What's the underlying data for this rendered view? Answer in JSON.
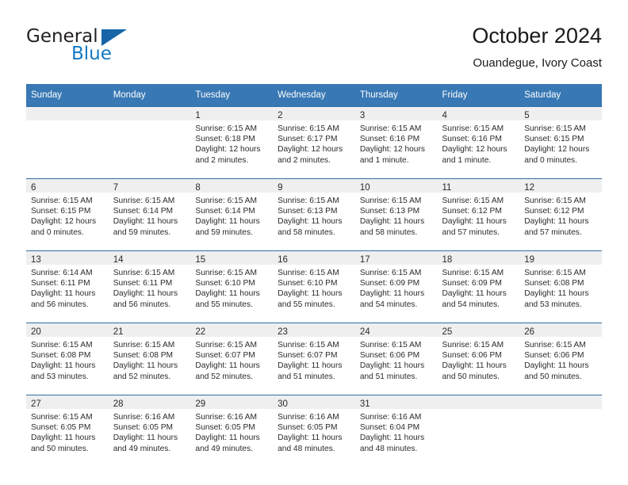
{
  "brand": {
    "name_top": "General",
    "name_bottom": "Blue",
    "accent_color": "#1579c4",
    "triangle_color": "#1565a8"
  },
  "header": {
    "title": "October 2024",
    "subtitle": "Ouandegue, Ivory Coast"
  },
  "theme": {
    "header_row_bg": "#3878b4",
    "daynum_band_bg": "#efefef",
    "row_border": "#2f6fa8",
    "text": "#2b2b2b"
  },
  "calendar": {
    "weekday_headers": [
      "Sunday",
      "Monday",
      "Tuesday",
      "Wednesday",
      "Thursday",
      "Friday",
      "Saturday"
    ],
    "weeks": [
      [
        {
          "day": ""
        },
        {
          "day": ""
        },
        {
          "day": "1",
          "sunrise": "Sunrise: 6:15 AM",
          "sunset": "Sunset: 6:18 PM",
          "daylight_1": "Daylight: 12 hours",
          "daylight_2": "and 2 minutes."
        },
        {
          "day": "2",
          "sunrise": "Sunrise: 6:15 AM",
          "sunset": "Sunset: 6:17 PM",
          "daylight_1": "Daylight: 12 hours",
          "daylight_2": "and 2 minutes."
        },
        {
          "day": "3",
          "sunrise": "Sunrise: 6:15 AM",
          "sunset": "Sunset: 6:16 PM",
          "daylight_1": "Daylight: 12 hours",
          "daylight_2": "and 1 minute."
        },
        {
          "day": "4",
          "sunrise": "Sunrise: 6:15 AM",
          "sunset": "Sunset: 6:16 PM",
          "daylight_1": "Daylight: 12 hours",
          "daylight_2": "and 1 minute."
        },
        {
          "day": "5",
          "sunrise": "Sunrise: 6:15 AM",
          "sunset": "Sunset: 6:15 PM",
          "daylight_1": "Daylight: 12 hours",
          "daylight_2": "and 0 minutes."
        }
      ],
      [
        {
          "day": "6",
          "sunrise": "Sunrise: 6:15 AM",
          "sunset": "Sunset: 6:15 PM",
          "daylight_1": "Daylight: 12 hours",
          "daylight_2": "and 0 minutes."
        },
        {
          "day": "7",
          "sunrise": "Sunrise: 6:15 AM",
          "sunset": "Sunset: 6:14 PM",
          "daylight_1": "Daylight: 11 hours",
          "daylight_2": "and 59 minutes."
        },
        {
          "day": "8",
          "sunrise": "Sunrise: 6:15 AM",
          "sunset": "Sunset: 6:14 PM",
          "daylight_1": "Daylight: 11 hours",
          "daylight_2": "and 59 minutes."
        },
        {
          "day": "9",
          "sunrise": "Sunrise: 6:15 AM",
          "sunset": "Sunset: 6:13 PM",
          "daylight_1": "Daylight: 11 hours",
          "daylight_2": "and 58 minutes."
        },
        {
          "day": "10",
          "sunrise": "Sunrise: 6:15 AM",
          "sunset": "Sunset: 6:13 PM",
          "daylight_1": "Daylight: 11 hours",
          "daylight_2": "and 58 minutes."
        },
        {
          "day": "11",
          "sunrise": "Sunrise: 6:15 AM",
          "sunset": "Sunset: 6:12 PM",
          "daylight_1": "Daylight: 11 hours",
          "daylight_2": "and 57 minutes."
        },
        {
          "day": "12",
          "sunrise": "Sunrise: 6:15 AM",
          "sunset": "Sunset: 6:12 PM",
          "daylight_1": "Daylight: 11 hours",
          "daylight_2": "and 57 minutes."
        }
      ],
      [
        {
          "day": "13",
          "sunrise": "Sunrise: 6:14 AM",
          "sunset": "Sunset: 6:11 PM",
          "daylight_1": "Daylight: 11 hours",
          "daylight_2": "and 56 minutes."
        },
        {
          "day": "14",
          "sunrise": "Sunrise: 6:15 AM",
          "sunset": "Sunset: 6:11 PM",
          "daylight_1": "Daylight: 11 hours",
          "daylight_2": "and 56 minutes."
        },
        {
          "day": "15",
          "sunrise": "Sunrise: 6:15 AM",
          "sunset": "Sunset: 6:10 PM",
          "daylight_1": "Daylight: 11 hours",
          "daylight_2": "and 55 minutes."
        },
        {
          "day": "16",
          "sunrise": "Sunrise: 6:15 AM",
          "sunset": "Sunset: 6:10 PM",
          "daylight_1": "Daylight: 11 hours",
          "daylight_2": "and 55 minutes."
        },
        {
          "day": "17",
          "sunrise": "Sunrise: 6:15 AM",
          "sunset": "Sunset: 6:09 PM",
          "daylight_1": "Daylight: 11 hours",
          "daylight_2": "and 54 minutes."
        },
        {
          "day": "18",
          "sunrise": "Sunrise: 6:15 AM",
          "sunset": "Sunset: 6:09 PM",
          "daylight_1": "Daylight: 11 hours",
          "daylight_2": "and 54 minutes."
        },
        {
          "day": "19",
          "sunrise": "Sunrise: 6:15 AM",
          "sunset": "Sunset: 6:08 PM",
          "daylight_1": "Daylight: 11 hours",
          "daylight_2": "and 53 minutes."
        }
      ],
      [
        {
          "day": "20",
          "sunrise": "Sunrise: 6:15 AM",
          "sunset": "Sunset: 6:08 PM",
          "daylight_1": "Daylight: 11 hours",
          "daylight_2": "and 53 minutes."
        },
        {
          "day": "21",
          "sunrise": "Sunrise: 6:15 AM",
          "sunset": "Sunset: 6:08 PM",
          "daylight_1": "Daylight: 11 hours",
          "daylight_2": "and 52 minutes."
        },
        {
          "day": "22",
          "sunrise": "Sunrise: 6:15 AM",
          "sunset": "Sunset: 6:07 PM",
          "daylight_1": "Daylight: 11 hours",
          "daylight_2": "and 52 minutes."
        },
        {
          "day": "23",
          "sunrise": "Sunrise: 6:15 AM",
          "sunset": "Sunset: 6:07 PM",
          "daylight_1": "Daylight: 11 hours",
          "daylight_2": "and 51 minutes."
        },
        {
          "day": "24",
          "sunrise": "Sunrise: 6:15 AM",
          "sunset": "Sunset: 6:06 PM",
          "daylight_1": "Daylight: 11 hours",
          "daylight_2": "and 51 minutes."
        },
        {
          "day": "25",
          "sunrise": "Sunrise: 6:15 AM",
          "sunset": "Sunset: 6:06 PM",
          "daylight_1": "Daylight: 11 hours",
          "daylight_2": "and 50 minutes."
        },
        {
          "day": "26",
          "sunrise": "Sunrise: 6:15 AM",
          "sunset": "Sunset: 6:06 PM",
          "daylight_1": "Daylight: 11 hours",
          "daylight_2": "and 50 minutes."
        }
      ],
      [
        {
          "day": "27",
          "sunrise": "Sunrise: 6:15 AM",
          "sunset": "Sunset: 6:05 PM",
          "daylight_1": "Daylight: 11 hours",
          "daylight_2": "and 50 minutes."
        },
        {
          "day": "28",
          "sunrise": "Sunrise: 6:16 AM",
          "sunset": "Sunset: 6:05 PM",
          "daylight_1": "Daylight: 11 hours",
          "daylight_2": "and 49 minutes."
        },
        {
          "day": "29",
          "sunrise": "Sunrise: 6:16 AM",
          "sunset": "Sunset: 6:05 PM",
          "daylight_1": "Daylight: 11 hours",
          "daylight_2": "and 49 minutes."
        },
        {
          "day": "30",
          "sunrise": "Sunrise: 6:16 AM",
          "sunset": "Sunset: 6:05 PM",
          "daylight_1": "Daylight: 11 hours",
          "daylight_2": "and 48 minutes."
        },
        {
          "day": "31",
          "sunrise": "Sunrise: 6:16 AM",
          "sunset": "Sunset: 6:04 PM",
          "daylight_1": "Daylight: 11 hours",
          "daylight_2": "and 48 minutes."
        },
        {
          "day": ""
        },
        {
          "day": ""
        }
      ]
    ]
  }
}
